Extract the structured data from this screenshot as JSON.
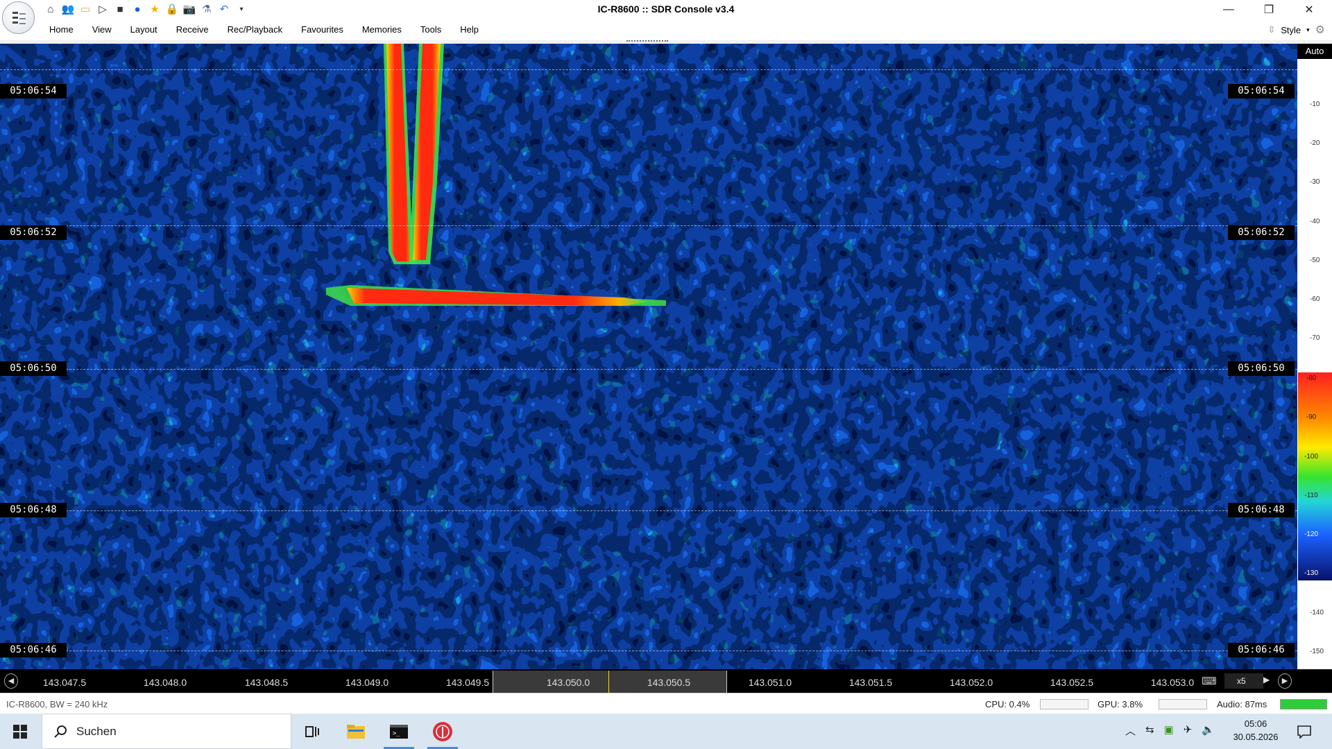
{
  "window": {
    "title": "IC-R8600 :: SDR Console v3.4"
  },
  "quick_access": [
    "home-icon",
    "users-icon",
    "folder-icon",
    "play-icon",
    "stop-icon",
    "globe-icon",
    "star-icon",
    "lock-icon",
    "camera-icon",
    "flask-icon",
    "undo-icon",
    "dropdown-icon"
  ],
  "menu": [
    "Home",
    "View",
    "Layout",
    "Receive",
    "Rec/Playback",
    "Favourites",
    "Memories",
    "Tools",
    "Help"
  ],
  "style_label": "Style",
  "waterfall": {
    "times": [
      "05:06:54",
      "05:06:52",
      "05:06:50",
      "05:06:48",
      "05:06:46"
    ],
    "colors": {
      "background": "#1340c8",
      "signal": "#ff2a10"
    }
  },
  "dbscale": {
    "auto_label": "Auto",
    "ticks": [
      "-10",
      "-20",
      "-30",
      "-40",
      "-50",
      "-60",
      "-70",
      "-80",
      "-90",
      "-100",
      "-110",
      "-120",
      "-130",
      "-140",
      "-150"
    ]
  },
  "freq_axis": {
    "labels": [
      "143.047.5",
      "143.048.0",
      "143.048.5",
      "143.049.0",
      "143.049.5",
      "143.050.0",
      "143.050.5",
      "143.051.0",
      "143.051.5",
      "143.052.0",
      "143.052.5",
      "143.053.0"
    ],
    "zoom": "x5"
  },
  "status": {
    "left": "IC-R8600, BW = 240 kHz",
    "cpu": "CPU: 0.4%",
    "gpu": "GPU: 3.8%",
    "audio": "Audio: 87ms"
  },
  "taskbar": {
    "search_placeholder": "Suchen",
    "time": "05:06",
    "date": "30.05.2026"
  }
}
